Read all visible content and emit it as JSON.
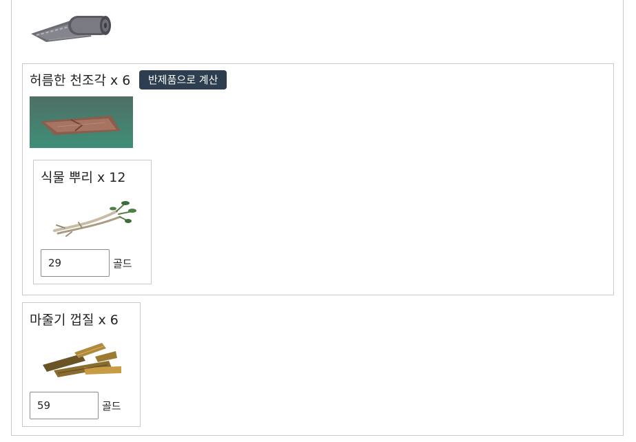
{
  "colors": {
    "button_bg": "#2c3e50",
    "border": "#c8c8c8"
  },
  "top_item": {
    "icon": "rolled-cloth-icon"
  },
  "cloth": {
    "title": "허름한 천조각 x 6",
    "calc_button": "반제품으로 계산",
    "icon": "torn-cloth-icon",
    "root": {
      "title": "식물 뿌리 x 12",
      "icon": "plant-root-icon",
      "price": "29",
      "unit": "골드"
    }
  },
  "bark": {
    "title": "마줄기 껍질 x 6",
    "icon": "bark-bundle-icon",
    "price": "59",
    "unit": "골드"
  }
}
